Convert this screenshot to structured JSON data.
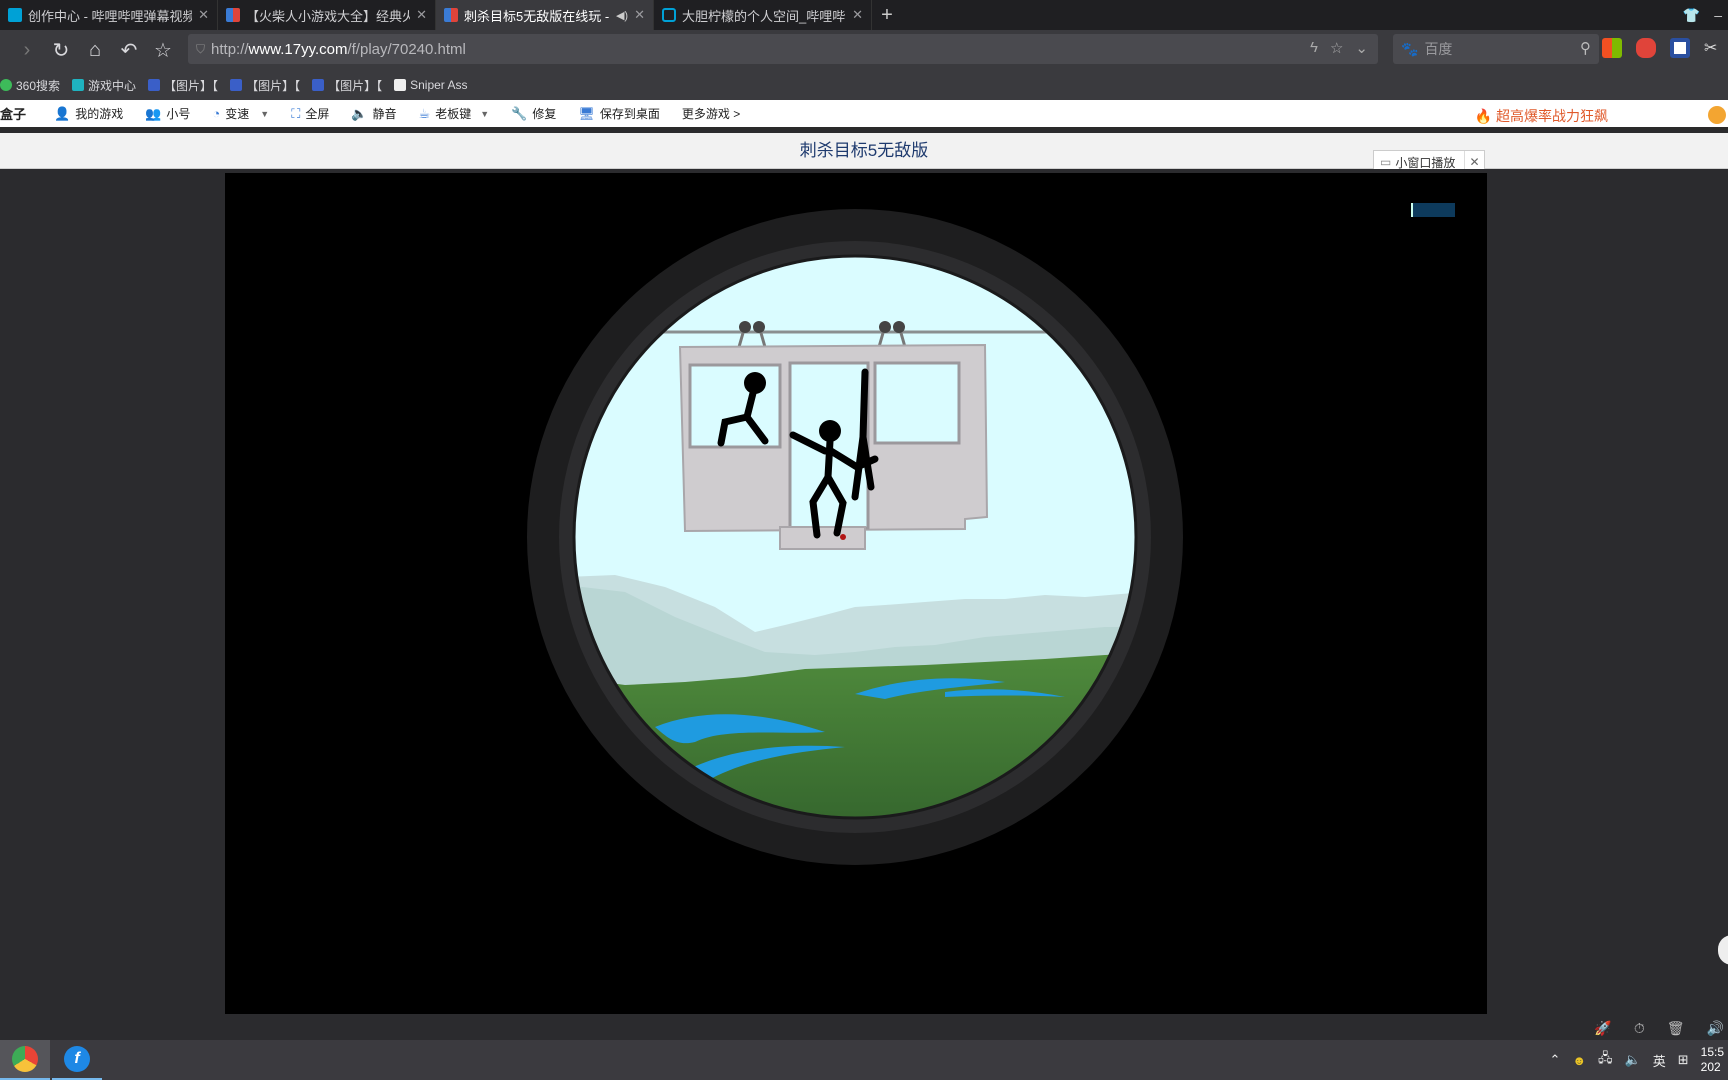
{
  "tabs": [
    {
      "title": "创作中心 - 哔哩哔哩弹幕视频",
      "active": false,
      "muted": false
    },
    {
      "title": "【火柴人小游戏大全】经典火",
      "active": false,
      "muted": false
    },
    {
      "title": "刺杀目标5无敌版在线玩 -",
      "active": true,
      "muted": true
    },
    {
      "title": "大胆柠檬的个人空间_哔哩哔哩",
      "active": false,
      "muted": false
    }
  ],
  "nav": {
    "url_prefix": "http://",
    "url_host": "www.17yy.com",
    "url_path": "/f/play/70240.html",
    "search_placeholder": "百度"
  },
  "bookmarks": [
    "360搜索",
    "游戏中心",
    "【图片】【",
    "【图片】【",
    "【图片】【",
    "Sniper Ass"
  ],
  "gamebar": {
    "box_label": "盒子",
    "items": [
      "我的游戏",
      "小号",
      "变速",
      "全屏",
      "静音",
      "老板键",
      "修复",
      "保存到桌面",
      "更多游戏 >"
    ],
    "promo": "超高爆率战力狂飙"
  },
  "game": {
    "title": "刺杀目标5无敌版",
    "small_window_label": "小窗口播放"
  },
  "taskbar": {
    "ime": "英",
    "time": "15:5",
    "date": "202"
  },
  "colors": {
    "sky": "#dafcff",
    "scope_ring": "#2c2c2e",
    "grass": "#3f7a36",
    "river": "#1f9be0",
    "promo": "#e05a2b",
    "title_text": "#1e3a6e"
  }
}
